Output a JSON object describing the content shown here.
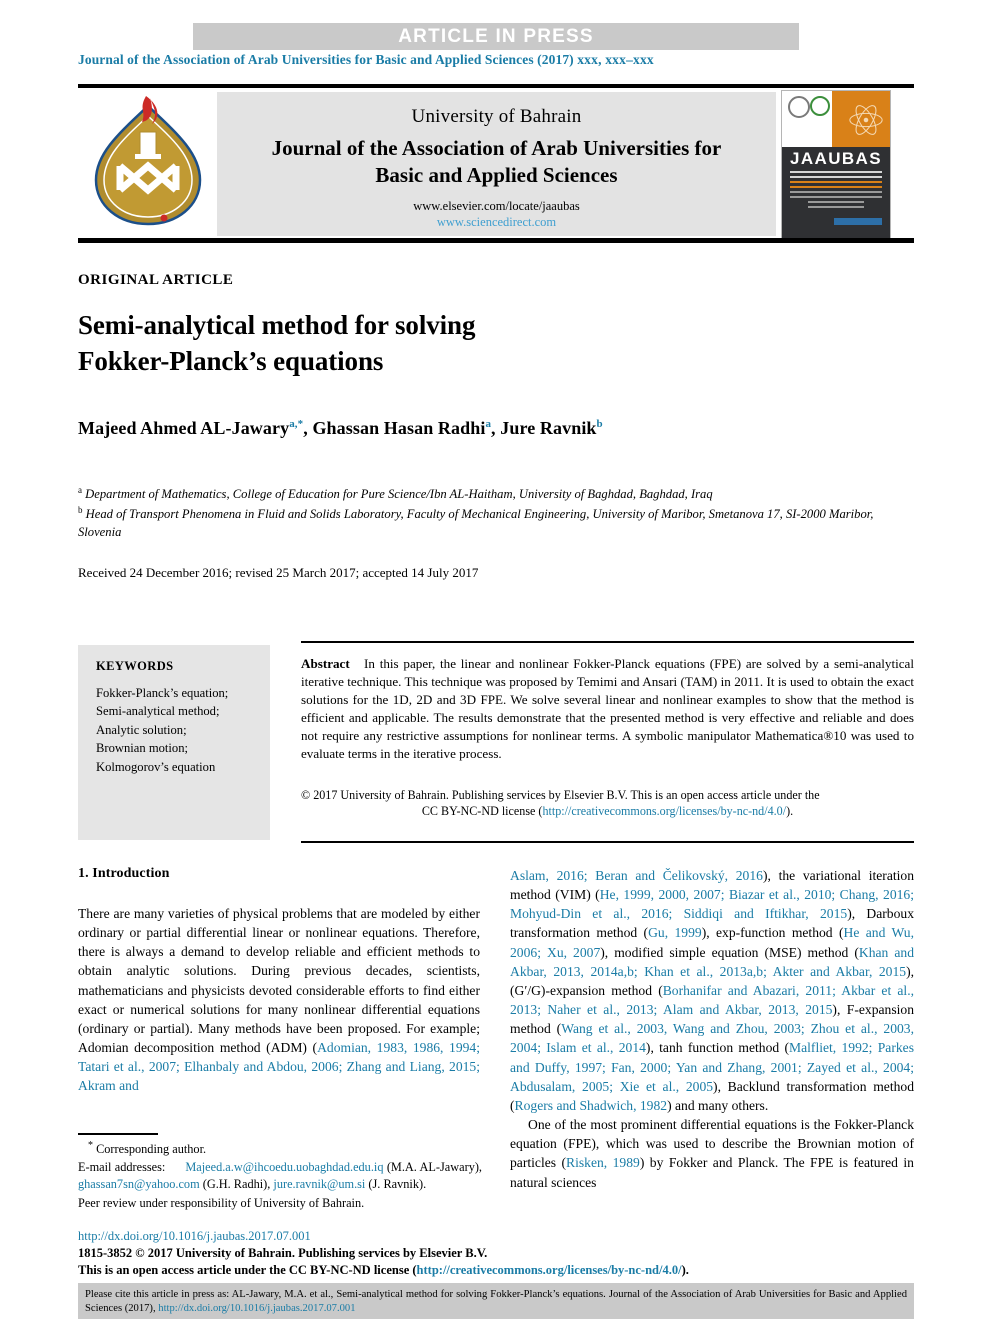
{
  "banner": {
    "label": "ARTICLE  IN  PRESS"
  },
  "running": {
    "text": "Journal of the Association of Arab Universities for Basic and Applied Sciences (2017) ",
    "volume": "xxx, xxx–xxx"
  },
  "masthead": {
    "university": "University of Bahrain",
    "journal_line1": "Journal of the Association of Arab Universities for",
    "journal_line2": "Basic and Applied Sciences",
    "url_elsevier": "www.elsevier.com/locate/jaaubas",
    "url_sciencedirect": "www.sciencedirect.com",
    "logo_name": "university-of-bahrain-logo",
    "cover_title": "JAAUBAS"
  },
  "article": {
    "type_label": "ORIGINAL ARTICLE",
    "title_line1": "Semi-analytical method for solving",
    "title_line2": "Fokker-Planck’s equations",
    "authors": [
      {
        "name": "Majeed Ahmed AL-Jawary",
        "sup": "a,*"
      },
      {
        "name": "Ghassan Hasan Radhi",
        "sup": "a"
      },
      {
        "name": "Jure Ravnik",
        "sup": "b"
      }
    ],
    "affiliations": [
      {
        "marker": "a",
        "text": "Department of Mathematics, College of Education for Pure Science/Ibn AL-Haitham, University of Baghdad, Baghdad, Iraq"
      },
      {
        "marker": "b",
        "text": "Head of Transport Phenomena in Fluid and Solids Laboratory, Faculty of Mechanical Engineering, University of Maribor, Smetanova 17, SI-2000 Maribor, Slovenia"
      }
    ],
    "history": "Received 24 December 2016; revised 25 March 2017; accepted 14 July 2017"
  },
  "keywords": {
    "title": "KEYWORDS",
    "items": [
      "Fokker-Planck’s equation;",
      "Semi-analytical method;",
      "Analytic solution;",
      "Brownian motion;",
      "Kolmogorov’s equation"
    ]
  },
  "abstract": {
    "label": "Abstract",
    "text": "In this paper, the linear and nonlinear Fokker-Planck equations (FPE) are solved by a semi-analytical iterative technique. This technique was proposed by Temimi and Ansari (TAM) in 2011. It is used to obtain the exact solutions for the 1D, 2D and 3D FPE. We solve several linear and nonlinear examples to show that the method is efficient and applicable. The results demonstrate that the presented method is very effective and reliable and does not require any restrictive assumptions for nonlinear terms. A symbolic manipulator Mathematica®10 was used to evaluate terms in the iterative process.",
    "copyright_line1": "© 2017 University of Bahrain. Publishing services by Elsevier B.V. This is an open access article under the",
    "copyright_line2_prefix": "CC BY-NC-ND license (",
    "copyright_license_url": "http://creativecommons.org/licenses/by-nc-nd/4.0/",
    "copyright_line2_suffix": ")."
  },
  "body": {
    "section_title": "1. Introduction",
    "left_paragraph": "There are many varieties of physical problems that are modeled by either ordinary or partial differential linear or nonlinear equations. Therefore, there is always a demand to develop reliable and efficient methods to obtain analytic solutions. During previous decades, scientists, mathematicians and physicists devoted considerable efforts to find either exact or numerical solutions for many nonlinear differential equations (ordinary or partial). Many methods have been proposed. For example; Adomian decomposition method (ADM) (",
    "left_refs_tail": "Adomian, 1983, 1986, 1994; Tatari et al., 2007; Elhanbaly and Abdou, 2006; Zhang and Liang, 2015; Akram and",
    "right_paragraph_1": [
      {
        "t": "Aslam, 2016; Beran and Čelikovský, 2016",
        "k": "ref"
      },
      {
        "t": "), the variational iteration method (VIM) (",
        "k": "txt"
      },
      {
        "t": "He, 1999, 2000, 2007; Biazar et al., 2010; Chang, 2016; Mohyud-Din et al., 2016; Siddiqi and Iftikhar, 2015",
        "k": "ref"
      },
      {
        "t": "), Darboux transformation method (",
        "k": "txt"
      },
      {
        "t": "Gu, 1999",
        "k": "ref"
      },
      {
        "t": "), exp-function method (",
        "k": "txt"
      },
      {
        "t": "He and Wu, 2006; Xu, 2007",
        "k": "ref"
      },
      {
        "t": "), modified simple equation (MSE) method (",
        "k": "txt"
      },
      {
        "t": "Khan and Akbar, 2013, 2014a,b; Khan et al., 2013a,b; Akter and Akbar, 2015",
        "k": "ref"
      },
      {
        "t": "), (G′/G)-expansion method (",
        "k": "txt"
      },
      {
        "t": "Borhanifar and Abazari, 2011; Akbar et al., 2013; Naher et al., 2013; Alam and Akbar, 2013, 2015",
        "k": "ref"
      },
      {
        "t": "), F-expansion method (",
        "k": "txt"
      },
      {
        "t": "Wang et al., 2003, Wang and Zhou, 2003; Zhou et al., 2003, 2004; Islam et al., 2014",
        "k": "ref"
      },
      {
        "t": "), tanh function method (",
        "k": "txt"
      },
      {
        "t": "Malfliet, 1992; Parkes and Duffy, 1997; Fan, 2000; Yan and Zhang, 2001; Zayed et al., 2004; Abdusalam, 2005; Xie et al., 2005",
        "k": "ref"
      },
      {
        "t": "), Backlund transformation method (",
        "k": "txt"
      },
      {
        "t": "Rogers and Shadwich, 1982",
        "k": "ref"
      },
      {
        "t": ") and many others.",
        "k": "txt"
      }
    ],
    "right_paragraph_2": [
      {
        "t": "One of the most prominent differential equations is the Fokker-Planck equation (FPE), which was used to describe the Brownian motion of particles (",
        "k": "txt"
      },
      {
        "t": "Risken, 1989",
        "k": "ref"
      },
      {
        "t": ") by Fokker and Planck. The FPE is featured in natural sciences",
        "k": "txt"
      }
    ]
  },
  "footnote": {
    "corresponding": "Corresponding author.",
    "email_label": "E-mail addresses:",
    "emails": [
      {
        "address": "Majeed.a.w@ihcoedu.uobaghdad.edu.iq",
        "owner": "(M.A. AL-Jawary),"
      },
      {
        "address": "ghassan7sn@yahoo.com",
        "owner": "(G.H. Radhi),"
      },
      {
        "address": "jure.ravnik@um.si",
        "owner": "(J. Ravnik)."
      }
    ],
    "peer_review": "Peer review under responsibility of University of Bahrain."
  },
  "footer": {
    "doi": "http://dx.doi.org/10.1016/j.jaubas.2017.07.001",
    "issn_line": "1815-3852 © 2017 University of Bahrain. Publishing services by Elsevier B.V.",
    "oa_prefix": "This is an open access article under the CC BY-NC-ND license (",
    "oa_url": "http://creativecommons.org/licenses/by-nc-nd/4.0/",
    "oa_suffix": ")."
  },
  "cite_box": {
    "text_prefix": "Please cite this article in press as: AL-Jawary, M.A. et al., Semi-analytical method for solving Fokker-Planck’s equations. Journal of the Association of Arab Universities for Basic and Applied Sciences (2017), ",
    "link": "http://dx.doi.org/10.1016/j.jaubas.2017.07.001"
  },
  "colors": {
    "link": "#1a7ca6",
    "banner_bg": "#c9c9c9",
    "keyword_bg": "#e5e5e5",
    "masthead_bg": "#e3e3e3",
    "cover_orange": "#d98118"
  }
}
